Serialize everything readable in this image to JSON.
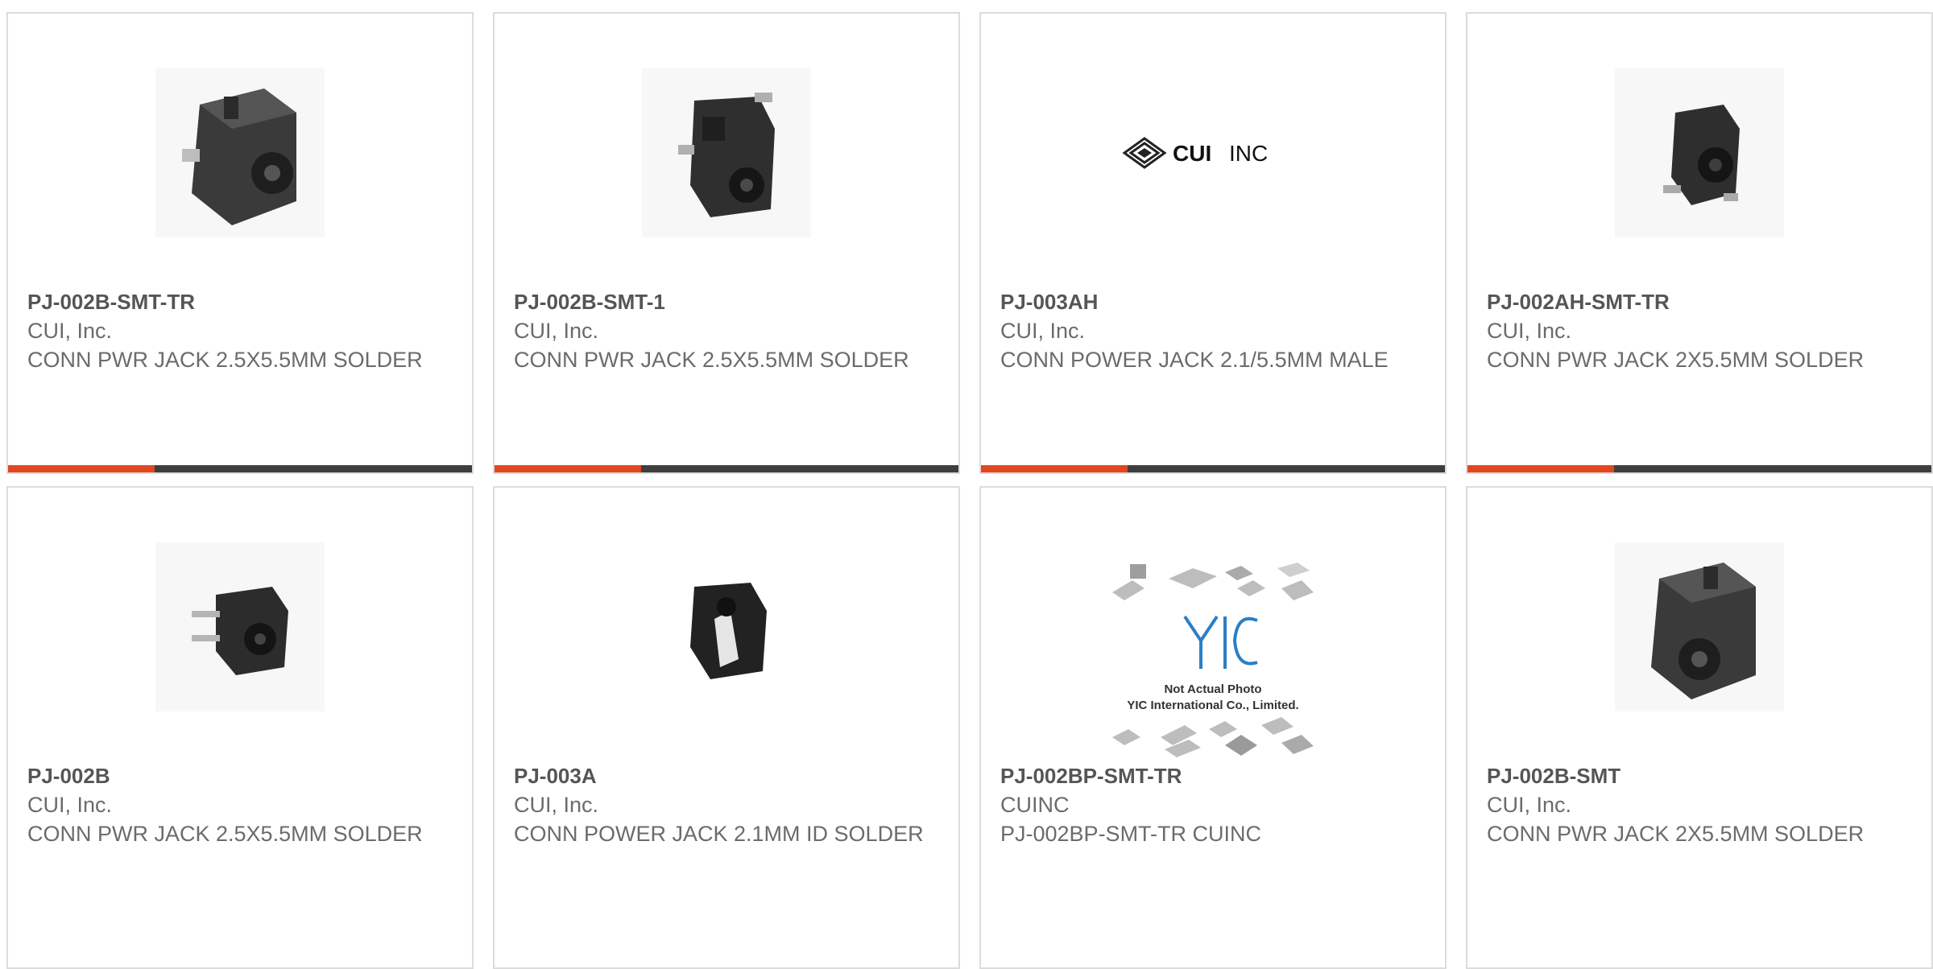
{
  "colors": {
    "accent": "#e2461e",
    "bar_dark": "#3e3e3e",
    "text_bold": "#555555",
    "text": "#6b6b6b",
    "border": "#dcdcdc"
  },
  "products": [
    {
      "part": "PJ-002B-SMT-TR",
      "mfr": "CUI, Inc.",
      "desc": "CONN PWR JACK 2.5X5.5MM SOLDER",
      "image": "smt-jack-photo"
    },
    {
      "part": "PJ-002B-SMT-1",
      "mfr": "CUI, Inc.",
      "desc": "CONN PWR JACK 2.5X5.5MM SOLDER",
      "image": "smt-jack-photo"
    },
    {
      "part": "PJ-003AH",
      "mfr": "CUI, Inc.",
      "desc": "CONN POWER JACK 2.1/5.5MM MALE",
      "image": "cui-inc-logo",
      "logo_text": "CUI",
      "logo_text2": "INC"
    },
    {
      "part": "PJ-002AH-SMT-TR",
      "mfr": "CUI, Inc.",
      "desc": "CONN PWR JACK 2X5.5MM SOLDER",
      "image": "smt-jack-photo"
    },
    {
      "part": "PJ-002B",
      "mfr": "CUI, Inc.",
      "desc": "CONN PWR JACK 2.5X5.5MM SOLDER",
      "image": "through-hole-jack-photo"
    },
    {
      "part": "PJ-003A",
      "mfr": "CUI, Inc.",
      "desc": "CONN POWER JACK 2.1MM ID SOLDER",
      "image": "jack-photo"
    },
    {
      "part": "PJ-002BP-SMT-TR",
      "mfr": "CUINC",
      "desc": "PJ-002BP-SMT-TR CUINC",
      "image": "yic-placeholder",
      "placeholder_line1": "Not Actual Photo",
      "placeholder_line2": "YIC International Co., Limited."
    },
    {
      "part": "PJ-002B-SMT",
      "mfr": "CUI, Inc.",
      "desc": "CONN PWR JACK 2X5.5MM SOLDER",
      "image": "smt-jack-photo"
    }
  ]
}
